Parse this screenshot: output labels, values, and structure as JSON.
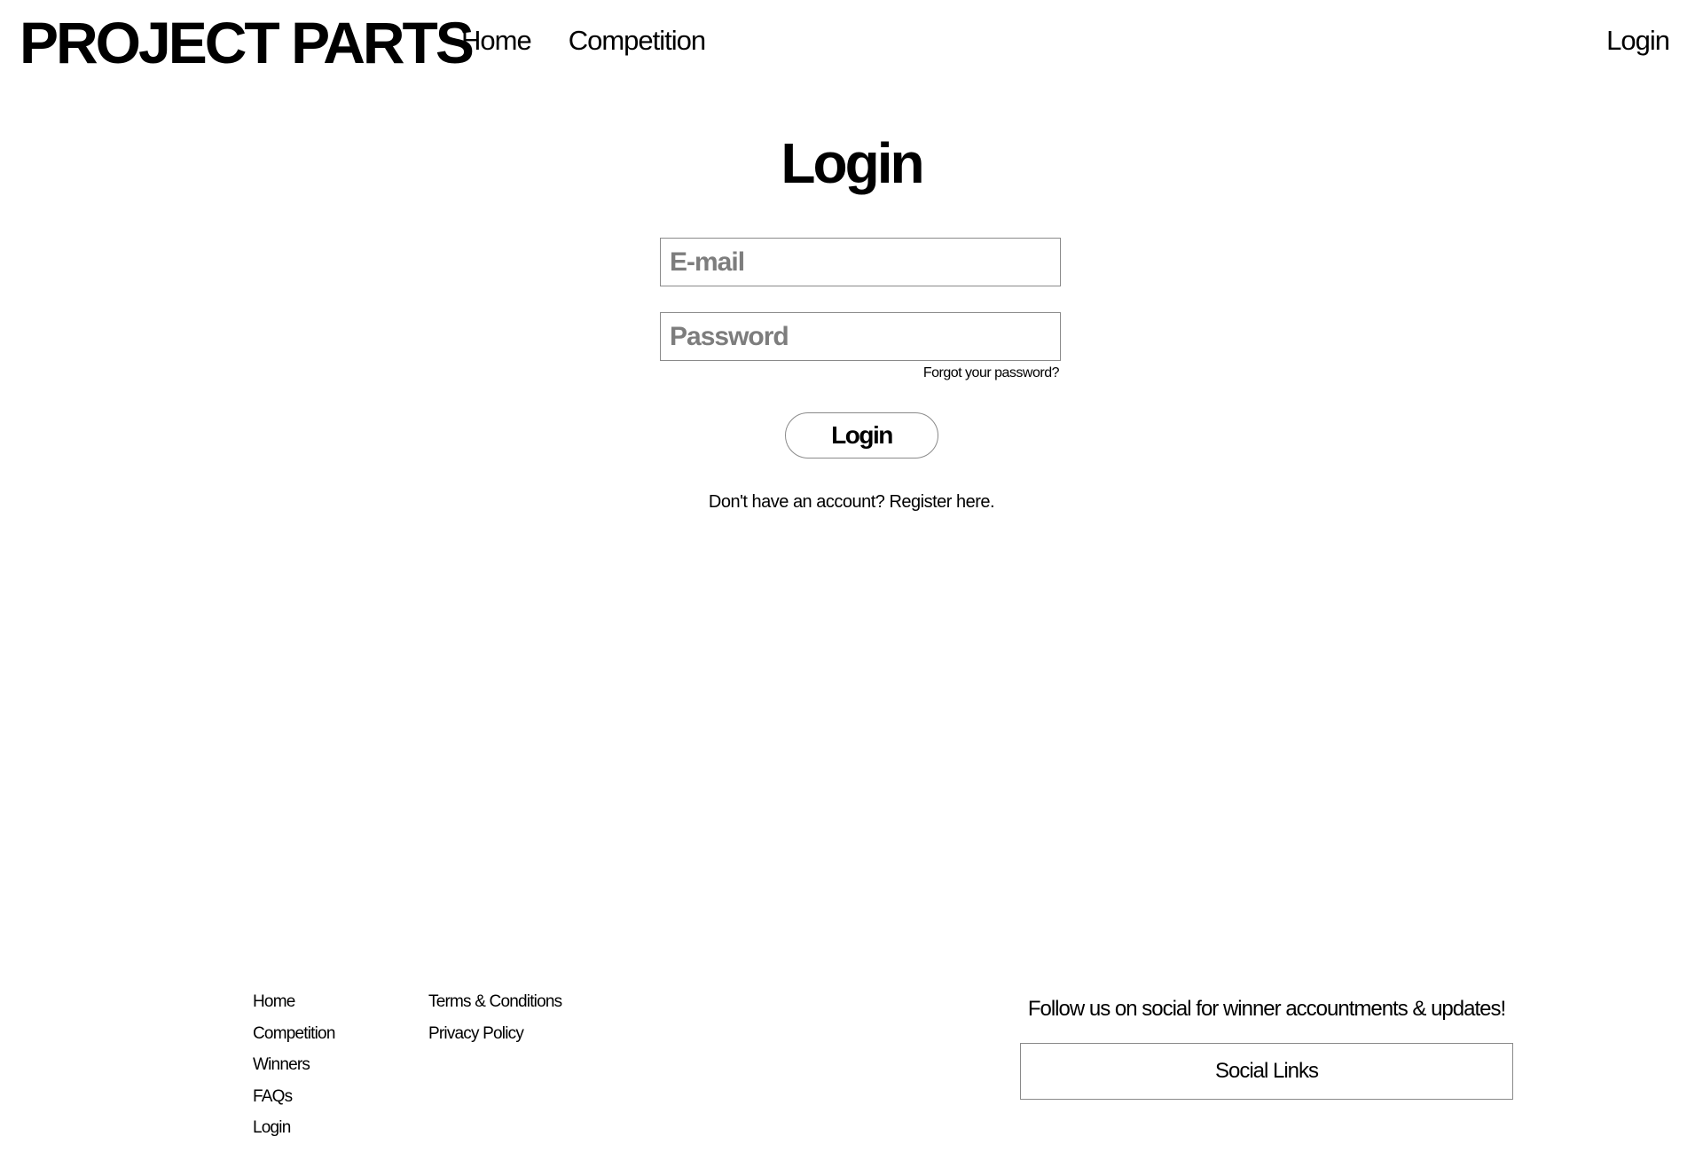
{
  "header": {
    "logo": "PROJECT PARTS",
    "nav": [
      {
        "label": "Home"
      },
      {
        "label": "Competition"
      }
    ],
    "login_link": "Login"
  },
  "login_form": {
    "title": "Login",
    "email_placeholder": "E-mail",
    "email_value": "",
    "password_placeholder": "Password",
    "password_value": "",
    "forgot_password": "Forgot your password?",
    "submit_label": "Login",
    "register_prompt": "Don't have an account?",
    "register_link": "Register here."
  },
  "footer": {
    "column1": [
      {
        "label": "Home"
      },
      {
        "label": "Competition"
      },
      {
        "label": "Winners"
      },
      {
        "label": "FAQs"
      },
      {
        "label": "Login"
      }
    ],
    "column2": [
      {
        "label": "Terms & Conditions"
      },
      {
        "label": "Privacy Policy"
      }
    ],
    "social_heading": "Follow us on social for winner accountments & updates!",
    "social_links_label": "Social Links"
  }
}
